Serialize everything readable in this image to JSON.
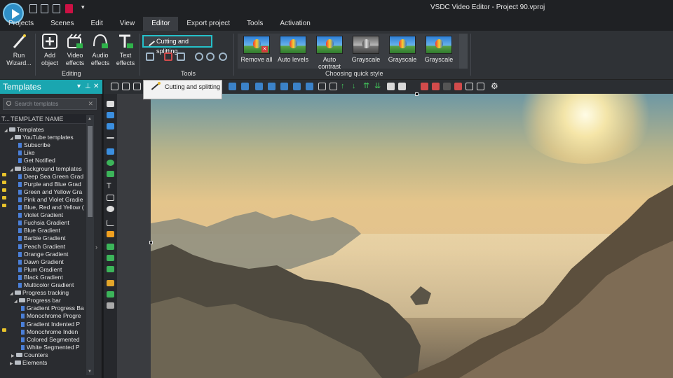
{
  "window": {
    "title": "VSDC Video Editor - Project 90.vproj"
  },
  "menu": [
    "Projects",
    "Scenes",
    "Edit",
    "View",
    "Editor",
    "Export project",
    "Tools",
    "Activation"
  ],
  "menu_active": "Editor",
  "ribbon": {
    "run_wizard": "Run Wizard...",
    "add_object": "Add object",
    "video_effects": "Video effects",
    "audio_effects": "Audio effects",
    "text_effects": "Text effects",
    "editing_label": "Editing",
    "cutting_button": "Cutting and splitting",
    "tools_label": "Tools",
    "quick_style_label": "Choosing quick style",
    "quick_styles": [
      "Remove all",
      "Auto levels",
      "Auto contrast",
      "Grayscale",
      "Grayscale",
      "Grayscale"
    ]
  },
  "tooltip": {
    "text": "Cutting and splitting"
  },
  "templates_panel": {
    "title": "Templates",
    "search_placeholder": "Search templates",
    "col_type": "T...",
    "col_name": "TEMPLATE NAME",
    "tree": [
      "Templates",
      "YouTube templates",
      "Subscribe",
      "Like",
      "Get Notified",
      "Background templates",
      "Deep Sea Green Grad",
      "Purple and Blue Grad",
      "Green and Yellow Gra",
      "Pink and Violet Gradie",
      "Blue, Red and Yellow (",
      "Violet Gradient",
      "Fuchsia Gradient",
      "Blue Gradient",
      "Barbie Gradient",
      "Peach Gradient",
      "Orange Gradient",
      "Dawn Gradient",
      "Plum Gradient",
      "Black Gradient",
      "Multicolor Gradient",
      "Progress tracking",
      "Progress bar",
      "Gradient Progress Ba",
      "Monochrome Progre",
      "Gradient Indented P",
      "Monochrome Inden",
      "Colored Segmented",
      "White Segmented P",
      "Counters",
      "Elements"
    ]
  },
  "colors": {
    "accent": "#1aa6b0",
    "highlight": "#25c0c9"
  }
}
